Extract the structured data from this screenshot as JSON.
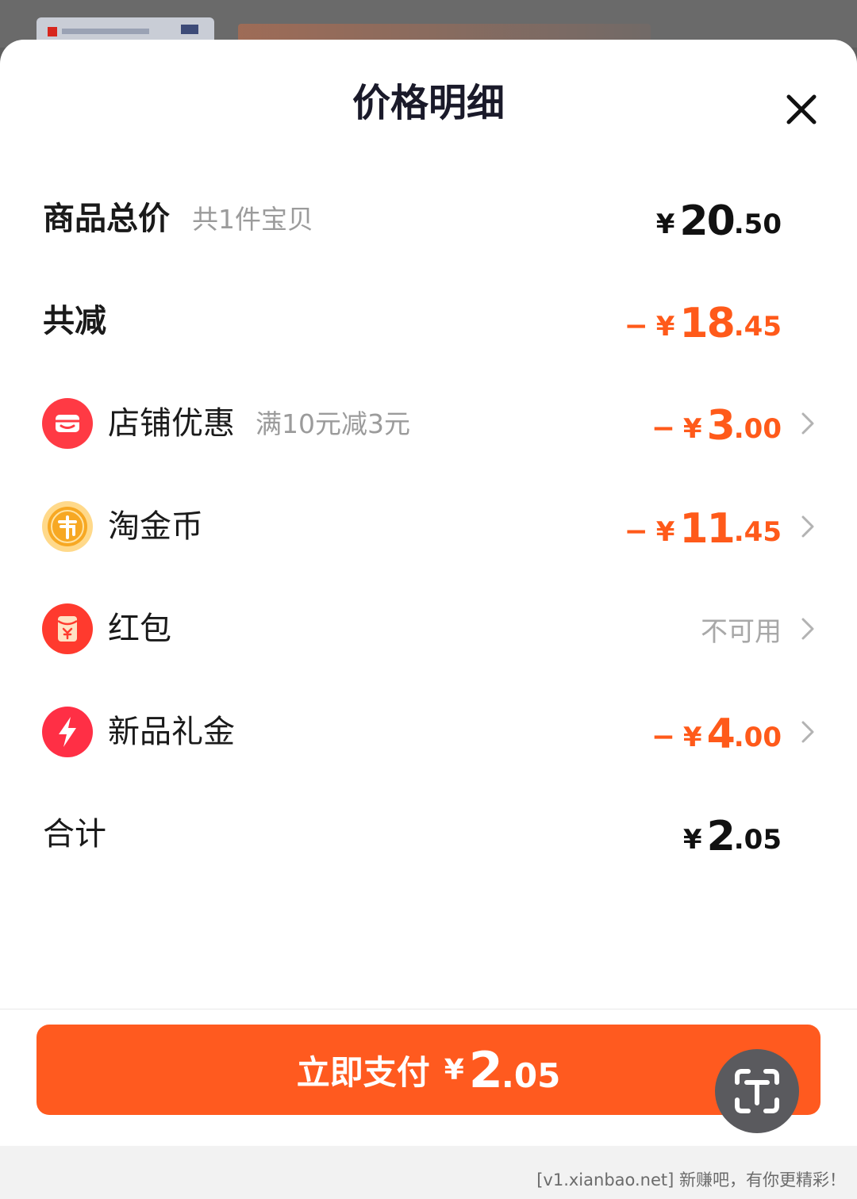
{
  "sheet": {
    "title": "价格明细"
  },
  "rows": {
    "subtotal": {
      "label": "商品总价",
      "sub": "共1件宝贝",
      "yen": "¥",
      "int": "20",
      "dec": ".50"
    },
    "reduction": {
      "label": "共减",
      "minus": "−",
      "yen": "¥",
      "int": "18",
      "dec": ".45"
    },
    "shop": {
      "label": "店铺优惠",
      "sub": "满10元减3元",
      "minus": "−",
      "yen": "¥",
      "int": "3",
      "dec": ".00",
      "icon": "shop-icon"
    },
    "coins": {
      "label": "淘金币",
      "minus": "−",
      "yen": "¥",
      "int": "11",
      "dec": ".45",
      "icon": "coin-icon"
    },
    "redpacket": {
      "label": "红包",
      "value": "不可用",
      "icon": "red-packet-icon"
    },
    "newgift": {
      "label": "新品礼金",
      "minus": "−",
      "yen": "¥",
      "int": "4",
      "dec": ".00",
      "icon": "lightning-icon"
    },
    "total": {
      "label": "合计",
      "yen": "¥",
      "int": "2",
      "dec": ".05"
    }
  },
  "pay": {
    "label": "立即支付",
    "yen": "¥",
    "int": "2",
    "dec": ".05"
  },
  "watermark": "[v1.xianbao.net] 新赚吧，有你更精彩！",
  "colors": {
    "accent": "#ff5a1f",
    "amount_orange": "#ff5a1a",
    "text_dark": "#1a1a1a",
    "text_gray": "#9b9b9b"
  }
}
